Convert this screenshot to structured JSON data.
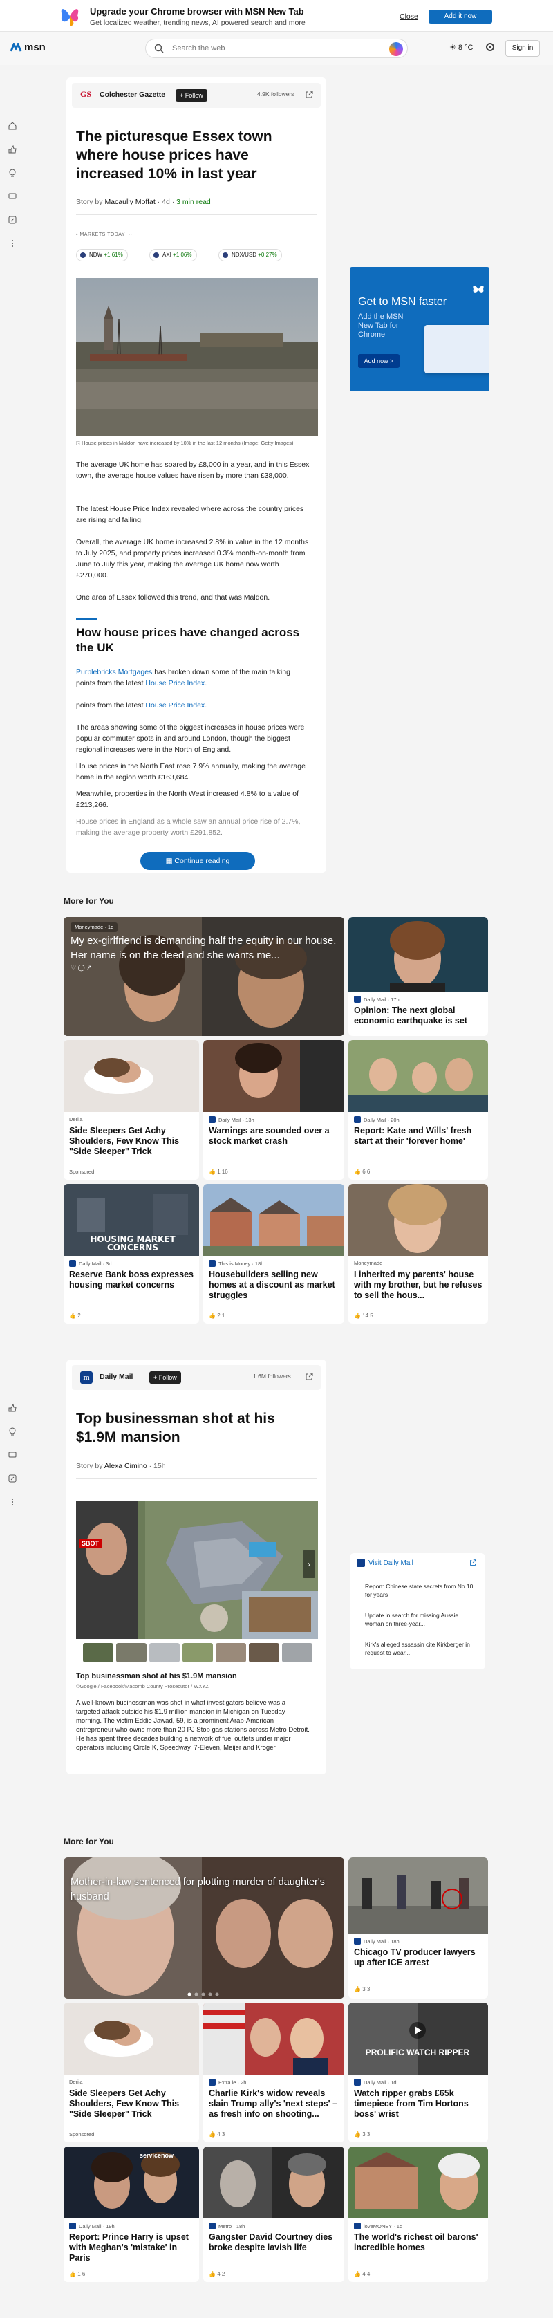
{
  "banner": {
    "title": "Upgrade your Chrome browser with MSN New Tab",
    "subtitle": "Get localized weather, trending news, AI powered search and more",
    "close": "Close",
    "add": "Add it now"
  },
  "topbar": {
    "brand": "msn",
    "search_placeholder": "Search the web",
    "weather": "8 °C",
    "signin": "Sign in"
  },
  "article1": {
    "publisher": "Colchester Gazette",
    "publisher_mark": "GS",
    "follow": "+ Follow",
    "followers": "4.9K followers",
    "title": "The picturesque Essex town where house prices have increased 10% in last year",
    "story_by": "Story by",
    "author": "Macaully Moffat",
    "age": "· 4d ·",
    "read": "3 min read",
    "markets_label": "MARKETS TODAY",
    "markets": [
      {
        "name": "NDW",
        "change": "+1.61%"
      },
      {
        "name": "AXI",
        "change": "+1.06%"
      },
      {
        "name": "NDX/USD",
        "change": "+0.27%"
      }
    ],
    "caption": "House prices in Maldon have increased by 10% in the last 12 months (Image: Getty Images)",
    "p1": "The average UK home has soared by £8,000 in a year, and in this Essex town, the average house values have risen by more than £38,000.",
    "p2": "The latest House Price Index revealed where across the country prices are rising and falling.",
    "p3": "Overall, the average UK home increased 2.8% in value in the 12 months to July 2025, and property prices increased 0.3% month-on-month from June to July this year, making the average UK home now worth £270,000.",
    "p4": "One area of Essex followed this trend, and that was Maldon.",
    "subheading": "How house prices have changed across the UK",
    "p5a": "Purplebricks Mortgages",
    "p5b": " has broken down some of the main talking points from the latest ",
    "p5c": "House Price Index",
    "p5d": ".",
    "p6a": "points from the latest ",
    "p6b": "House Price Index",
    "p6c": ".",
    "p7": "The areas showing some of the biggest increases in house prices were popular commuter spots in and around London, though the biggest regional increases were in the North of England.",
    "p8": "House prices in the North East rose 7.9% annually, making the average home in the region worth £163,684.",
    "p9": "Meanwhile, properties in the North West increased 4.8% to a value of £213,266.",
    "p10": "House prices in England as a whole saw an annual price rise of 2.7%, making the average property worth £291,852.",
    "continue": "Continue reading"
  },
  "ad": {
    "headline": "Get to MSN faster",
    "sub": "Add the MSN New Tab for Chrome",
    "button": "Add now >"
  },
  "feed1": {
    "header": "More for You",
    "hero": {
      "source": "Moneymade · 1d",
      "title": "My ex-girlfriend is demanding half the equity in our house. Her name is on the deed and she wants me..."
    },
    "tiles": [
      {
        "source": "Daily Mail · 17h",
        "title": "Opinion: The next global economic earthquake is set"
      },
      {
        "source": "Derila",
        "title": "Side Sleepers Get Achy Shoulders, Few Know This \"Side Sleeper\" Trick",
        "sponsored": "Sponsored"
      },
      {
        "source": "Daily Mail · 13h",
        "title": "Warnings are sounded over a stock market crash",
        "reactions": "1   16"
      },
      {
        "source": "Daily Mail · 20h",
        "title": "Report: Kate and Wills' fresh start at their 'forever home'",
        "reactions": "6   6"
      },
      {
        "source": "Daily Mail · 3d",
        "title": "Reserve Bank boss expresses housing market concerns",
        "reactions": "2"
      },
      {
        "source": "This is Money · 18h",
        "title": "Housebuilders selling new homes at a discount as market struggles",
        "reactions": "2   1"
      },
      {
        "source": "Moneymade",
        "title": "I inherited my parents' house with my brother, but he refuses to sell the hous...",
        "reactions": "14   5"
      }
    ],
    "img_text_1": "HOUSING MARKET CONCERNS"
  },
  "article2": {
    "publisher": "Daily Mail",
    "follow": "+ Follow",
    "followers": "1.6M followers",
    "title": "Top businessman shot at his $1.9M mansion",
    "story_by": "Story by",
    "author": "Alexa Cimino",
    "age": "· 15h",
    "badge": "SBOT",
    "caption_title": "Top businessman shot at his $1.9M mansion",
    "caption_credit": "©Google / Facebook/Macomb County Prosecutor / WXYZ",
    "body": "A well-known businessman was shot in what investigators believe was a targeted attack outside his $1.9 million mansion in Michigan on Tuesday morning. The victim Eddie Jawad, 59, is a prominent Arab-American entrepreneur who owns more than 20 PJ Stop gas stations across Metro Detroit. He has spent three decades building a network of fuel outlets under major operators including Circle K, Speedway, 7-Eleven, Meijer and Kroger."
  },
  "dmside": {
    "heading": "Visit Daily Mail",
    "items": [
      "Report: Chinese state secrets from No.10 for years",
      "Update in search for missing Aussie woman on three-year...",
      "Kirk's alleged assassin cite Kirkberger in request to wear..."
    ]
  },
  "feed2": {
    "header": "More for You",
    "hero": {
      "title": "Mother-in-law sentenced for plotting murder of daughter's husband"
    },
    "tiles": [
      {
        "source": "Daily Mail · 18h",
        "title": "Chicago TV producer lawyers up after ICE arrest",
        "reactions": "3   3"
      },
      {
        "source": "Derila",
        "title": "Side Sleepers Get Achy Shoulders, Few Know This \"Side Sleeper\" Trick",
        "sponsored": "Sponsored"
      },
      {
        "source": "Extra.ie · 2h",
        "title": "Charlie Kirk's widow reveals slain Trump ally's 'next steps' – as fresh info on shooting...",
        "reactions": "4   3"
      },
      {
        "source": "Daily Mail · 1d",
        "title": "Watch ripper grabs £65k timepiece from Tim Hortons boss' wrist",
        "reactions": "3   3"
      },
      {
        "source": "Daily Mail · 19h",
        "title": "Report: Prince Harry is upset with Meghan's 'mistake' in Paris",
        "reactions": "1   6"
      },
      {
        "source": "Metro · 18h",
        "title": "Gangster David Courtney dies broke despite lavish life",
        "reactions": "4   2"
      },
      {
        "source": "loveMONEY · 1d",
        "title": "The world's richest oil barons' incredible homes",
        "reactions": "4   4"
      }
    ],
    "img_text_1": "PROLIFIC WATCH RIPPER",
    "img_text_2": "servicenow"
  },
  "colors": {
    "accent": "#0f6cbd",
    "green": "#0e7a0d"
  }
}
